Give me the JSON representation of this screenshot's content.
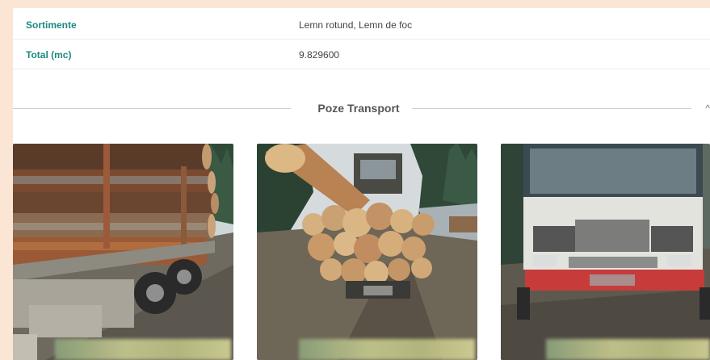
{
  "details": [
    {
      "label": "Sortimente",
      "value": "Lemn rotund, Lemn de foc"
    },
    {
      "label": "Total (mc)",
      "value": "9.829600"
    }
  ],
  "section": {
    "title": "Poze Transport",
    "edge_glyph": "^"
  },
  "photos": [
    {
      "subject": "truck-side-logs"
    },
    {
      "subject": "logs-rear-view"
    },
    {
      "subject": "truck-front-view"
    }
  ],
  "colors": {
    "page_bg": "#fbe6d6",
    "label_teal": "#1a8a80",
    "value_text": "#444444",
    "divider_line": "#cfcfcf"
  }
}
